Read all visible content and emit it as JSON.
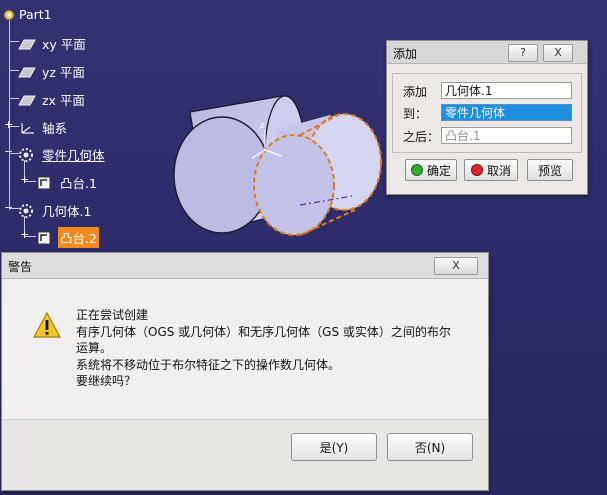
{
  "tree": {
    "root": "Part1",
    "planes": [
      "xy 平面",
      "yz 平面",
      "zx 平面"
    ],
    "axis_system": "轴系",
    "part_body": "零件几何体",
    "part_body_child": "凸台.1",
    "geometry_body": "几何体.1",
    "geometry_body_child": "凸台.2"
  },
  "add_dialog": {
    "title": "添加",
    "help_btn": "?",
    "close_btn": "X",
    "rows": [
      {
        "label": "添加",
        "value": "几何体.1"
      },
      {
        "label": "到：",
        "value": "零件几何体"
      },
      {
        "label": "之后：",
        "value": "凸台.1"
      }
    ],
    "ok": "确定",
    "cancel": "取消",
    "preview": "预览"
  },
  "warning": {
    "title": "警告",
    "close_btn": "X",
    "lines": [
      "正在尝试创建",
      "有序几何体（OGS 或几何体）和无序几何体（GS 或实体）之间的布尔",
      "运算。",
      "系统将不移动位于布尔特征之下的操作数几何体。",
      "要继续吗？"
    ],
    "yes": "是(Y)",
    "no": "否(N)"
  },
  "colors": {
    "background": "#2c2a6a",
    "selection": "#f08a1c",
    "field_selected": "#1e8fe0",
    "ok_dot": "#2fae2f",
    "cancel_dot": "#d92525"
  }
}
